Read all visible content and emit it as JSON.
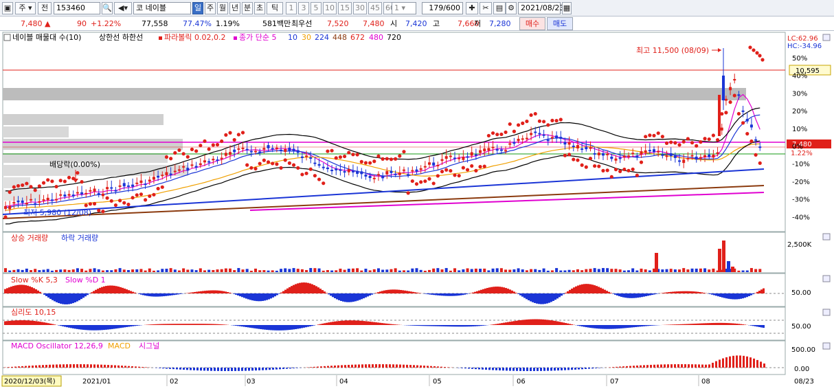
{
  "toolbar": {
    "period_select": "주",
    "prev_label": "전",
    "code": "153460",
    "market": "코",
    "name": "네이블",
    "periods": [
      "일",
      "주",
      "월",
      "년",
      "분",
      "초",
      "틱"
    ],
    "active_period": "일",
    "intervals": [
      "1",
      "3",
      "5",
      "10",
      "15",
      "30",
      "45",
      "60"
    ],
    "interval_input": "1",
    "count": "179/600",
    "date": "2021/08/23"
  },
  "quote": {
    "price": "7,480",
    "change": "90",
    "change_pct": "+1.22%",
    "volume": "77,558",
    "vol_ratio": "77.47%",
    "turnover": "1.19%",
    "amount": "581백만",
    "best_label": "최우선",
    "ask": "7,520",
    "bid": "7,480",
    "open_label": "시",
    "open": "7,420",
    "high_label": "고",
    "high": "7,660",
    "low_label": "저",
    "low": "7,280",
    "buy_label": "매수",
    "sell_label": "매도"
  },
  "legend": {
    "title": "네이블 매물대 수(10)",
    "env": "상한선 하한선",
    "parabolic": "파라볼릭 0.02,0.2",
    "ma_label": "종가 단순 5",
    "ma_periods": [
      {
        "p": "10",
        "color": "#1a35d6"
      },
      {
        "p": "30",
        "color": "#f0a000"
      },
      {
        "p": "224",
        "color": "#1a35d6"
      },
      {
        "p": "448",
        "color": "#8b3a0e"
      },
      {
        "p": "672",
        "color": "#e0201a"
      },
      {
        "p": "480",
        "color": "#e000d0"
      },
      {
        "p": "720",
        "color": "#000000"
      }
    ]
  },
  "annotations": {
    "high_note": "최고 11,500 (08/09)",
    "low_note": "최저 5,980 (12/08)",
    "dividend": "배당락(0.00%)",
    "lc": "LC:62.96",
    "hc": "HC:-34.96",
    "price_tag": "10,595",
    "last_price_tag": "7,480",
    "last_pct_tag": "1.22%"
  },
  "axes": {
    "price_pct": [
      "50%",
      "40%",
      "30%",
      "20%",
      "10%",
      "0%",
      "-10%",
      "-20%",
      "-30%",
      "-40%"
    ],
    "volume": "2,500K",
    "stoch": "50.00",
    "psy": "50.00",
    "macd_top": "500.00",
    "macd_mid": "0.00",
    "dates": [
      "2021/01",
      "02",
      "03",
      "04",
      "05",
      "06",
      "07",
      "08"
    ],
    "start_date": "2020/12/03(목)",
    "end_date": "08/23"
  },
  "panels": {
    "volume": {
      "up": "상승 거래량",
      "down": "하락 거래량"
    },
    "stoch": {
      "k": "Slow %K 5,3",
      "d": "Slow %D 1"
    },
    "psy": {
      "label": "심리도 10,15"
    },
    "macd": {
      "osc": "MACD Oscillator 12,26,9",
      "macd": "MACD",
      "signal": "시그널"
    }
  },
  "colors": {
    "up": "#e0201a",
    "down": "#1a35d6",
    "pink": "#e000d0",
    "orange": "#f0a000",
    "brown": "#8b3a0e"
  }
}
